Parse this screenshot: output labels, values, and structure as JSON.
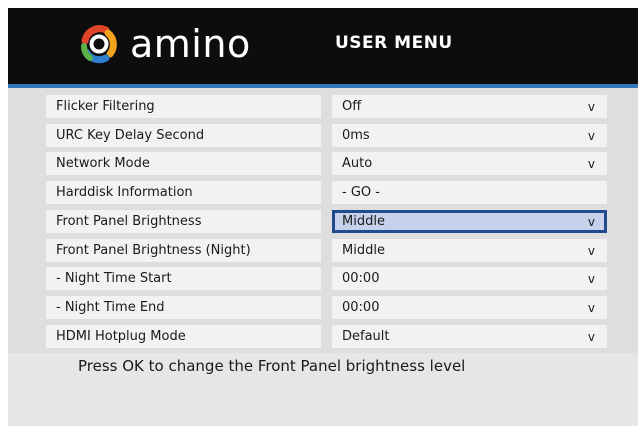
{
  "header": {
    "logo_text": "amino",
    "title": "USER MENU",
    "colors": {
      "background": "#0d0d0d",
      "stripe": "#2f78b8"
    }
  },
  "menu": {
    "items": [
      {
        "label": "Flicker Filtering",
        "value": "Off",
        "arrow": "v"
      },
      {
        "label": "URC Key Delay Second",
        "value": "0ms",
        "arrow": "v"
      },
      {
        "label": "Network Mode",
        "value": "Auto",
        "arrow": "v"
      },
      {
        "label": "Harddisk Information",
        "value": "- GO -",
        "arrow": ""
      },
      {
        "label": "Front Panel Brightness",
        "value": "Middle",
        "arrow": "v",
        "selected": true
      },
      {
        "label": "Front Panel Brightness (Night)",
        "value": "Middle",
        "arrow": "v"
      },
      {
        "label": "-  Night Time Start",
        "value": "00:00",
        "arrow": "v"
      },
      {
        "label": "-  Night Time End",
        "value": "00:00",
        "arrow": "v"
      },
      {
        "label": "HDMI Hotplug Mode",
        "value": "Default",
        "arrow": "v"
      }
    ],
    "colors": {
      "selected_fill": "#c7d1ec",
      "selected_border": "#224a8f"
    }
  },
  "help": {
    "text": "Press OK to change the Front Panel brightness level"
  }
}
